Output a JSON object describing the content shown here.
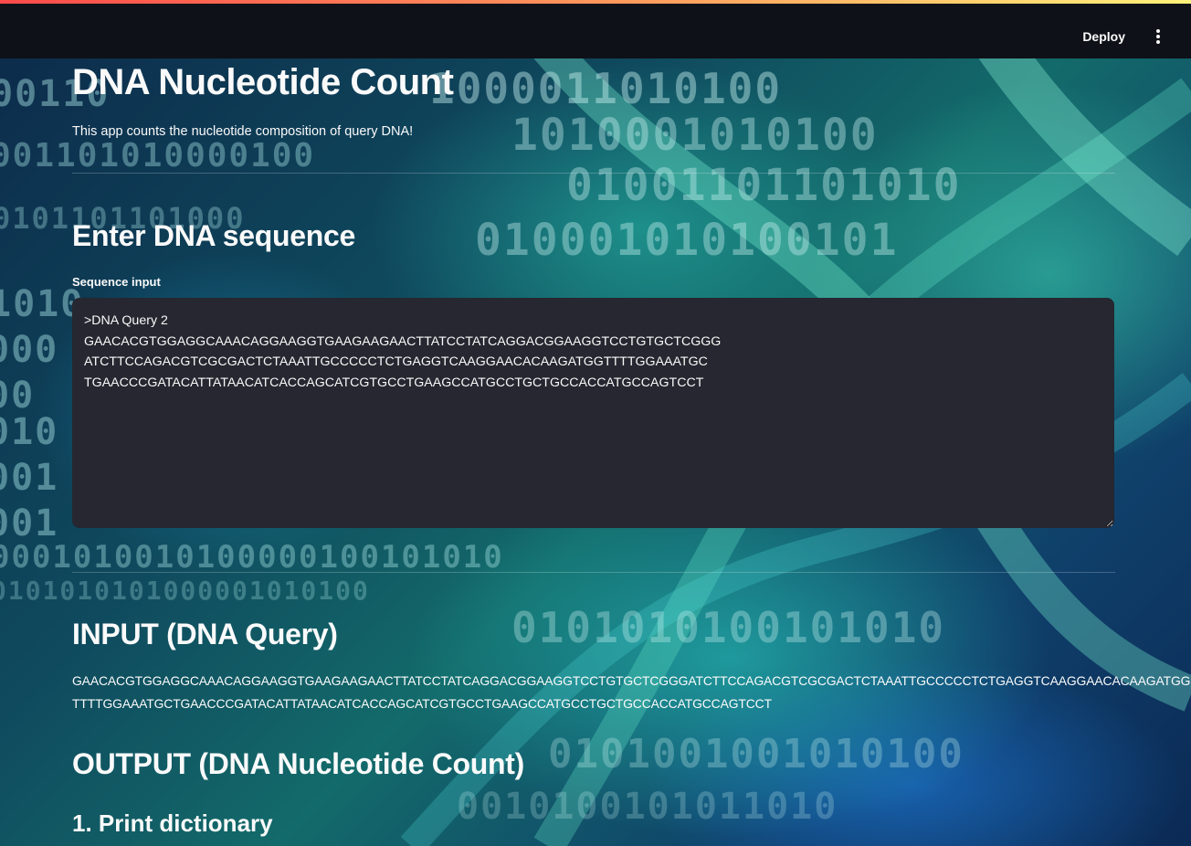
{
  "header": {
    "deploy_label": "Deploy",
    "menu_icon": "more-vertical-icon"
  },
  "app": {
    "title": "DNA Nucleotide Count",
    "subtitle": "This app counts the nucleotide composition of query DNA!"
  },
  "input_section": {
    "heading": "Enter DNA sequence",
    "field_label": "Sequence input",
    "value": ">DNA Query 2\nGAACACGTGGAGGCAAACAGGAAGGTGAAGAAGAACTTATCCTATCAGGACGGAAGGTCCTGTGCTCGGG\nATCTTCCAGACGTCGCGACTCTAAATTGCCCCCTCTGAGGTCAAGGAACACAAGATGGTTTTGGAAATGC\nTGAACCCGATACATTATAACATCACCAGCATCGTGCCTGAAGCCATGCCTGCTGCCACCATGCCAGTCCT"
  },
  "query_section": {
    "heading": "INPUT (DNA Query)",
    "lines": [
      "GAACACGTGGAGGCAAACAGGAAGGTGAAGAAGAACTTATCCTATCAGGACGGAAGGTCCTGTGCTCGGGATCTTCCAGACGTCGCGACTCTAAATTGCCCCCTCTGAGGTCAAGGAACACAAGATGG",
      "TTTTGGAAATGCTGAACCCGATACATTATAACATCACCAGCATCGTGCCTGAAGCCATGCCTGCTGCCACCATGCCAGTCCT"
    ]
  },
  "output_section": {
    "heading": "OUTPUT (DNA Nucleotide Count)",
    "subheading": "1. Print dictionary"
  },
  "colors": {
    "header_bg": "#0e1117",
    "textarea_bg": "#262730",
    "text": "#fafafa",
    "accent_stripe": [
      "#ff4b4b",
      "#fff27a"
    ]
  }
}
